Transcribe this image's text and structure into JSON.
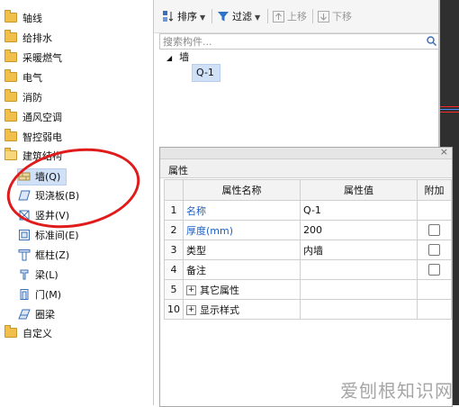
{
  "tree": {
    "categories": [
      {
        "label": "轴线"
      },
      {
        "label": "给排水"
      },
      {
        "label": "采暖燃气"
      },
      {
        "label": "电气"
      },
      {
        "label": "消防"
      },
      {
        "label": "通风空调"
      },
      {
        "label": "智控弱电"
      },
      {
        "label": "建筑结构"
      },
      {
        "label": "自定义"
      }
    ],
    "structure_items": [
      {
        "label": "墙(Q)",
        "icon": "wall-icon",
        "selected": true
      },
      {
        "label": "现浇板(B)",
        "icon": "slab-icon"
      },
      {
        "label": "竖井(V)",
        "icon": "shaft-icon"
      },
      {
        "label": "标准间(E)",
        "icon": "standard-room-icon"
      },
      {
        "label": "框柱(Z)",
        "icon": "column-icon"
      },
      {
        "label": "梁(L)",
        "icon": "beam-icon"
      },
      {
        "label": "门(M)",
        "icon": "door-icon"
      },
      {
        "label": "圈梁",
        "icon": "ring-beam-icon"
      }
    ],
    "annotation_color": "#e01b1b"
  },
  "toolbar": {
    "sort_label": "排序",
    "filter_label": "过滤",
    "move_up_label": "上移",
    "move_down_label": "下移"
  },
  "search": {
    "placeholder": "搜索构件..."
  },
  "components": {
    "group_label": "墙",
    "items": [
      {
        "label": "Q-1"
      }
    ]
  },
  "properties": {
    "title": "属性",
    "headers": {
      "name": "属性名称",
      "value": "属性值",
      "extra": "附加"
    },
    "rows": [
      {
        "num": "1",
        "name": "名称",
        "value": "Q-1",
        "checkbox": false
      },
      {
        "num": "2",
        "name": "厚度(mm)",
        "value": "200",
        "checkbox": true
      },
      {
        "num": "3",
        "name": "类型",
        "value": "内墙",
        "checkbox": true
      },
      {
        "num": "4",
        "name": "备注",
        "value": "",
        "checkbox": true
      },
      {
        "num": "5",
        "name": "其它属性",
        "value": "",
        "checkbox": false
      },
      {
        "num": "10",
        "name": "显示样式",
        "value": "",
        "checkbox": false
      }
    ]
  },
  "watermark": "爱刨根知识网"
}
